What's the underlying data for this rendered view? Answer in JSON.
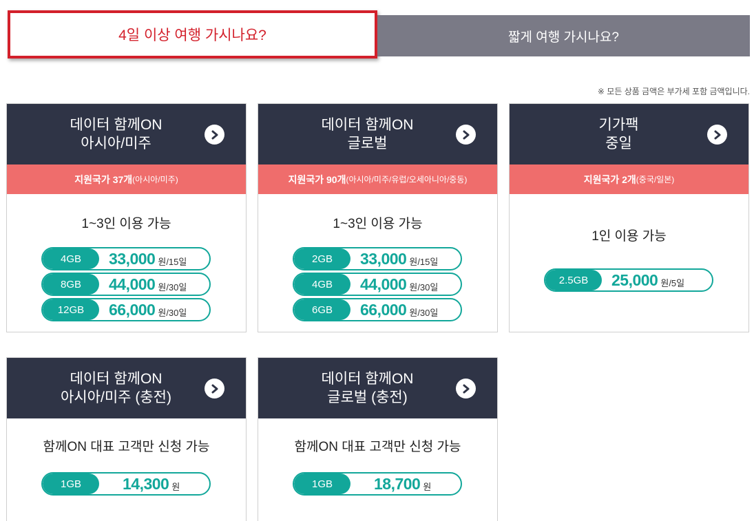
{
  "tabs": {
    "active_label": "4일 이상 여행 가시나요?",
    "inactive_label": "짧게 여행 가시나요?"
  },
  "vat_note": "※ 모든 상품 금액은 부가세 포함 금액입니다.",
  "cards": [
    {
      "title_line1": "데이터 함께ON",
      "title_line2": "아시아/미주",
      "support_main": "지원국가 37개",
      "support_detail": "(아시아/미주)",
      "usage": "1~3인 이용 가능",
      "plans": [
        {
          "gb": "4GB",
          "price": "33,000",
          "unit": "원/15일"
        },
        {
          "gb": "8GB",
          "price": "44,000",
          "unit": "원/30일"
        },
        {
          "gb": "12GB",
          "price": "66,000",
          "unit": "원/30일"
        }
      ]
    },
    {
      "title_line1": "데이터 함께ON",
      "title_line2": "글로벌",
      "support_main": "지원국가 90개",
      "support_detail": "(아시아/미주/유럽/오세아니아/중동)",
      "usage": "1~3인 이용 가능",
      "plans": [
        {
          "gb": "2GB",
          "price": "33,000",
          "unit": "원/15일"
        },
        {
          "gb": "4GB",
          "price": "44,000",
          "unit": "원/30일"
        },
        {
          "gb": "6GB",
          "price": "66,000",
          "unit": "원/30일"
        }
      ]
    },
    {
      "title_line1": "기가팩",
      "title_line2": "중일",
      "support_main": "지원국가 2개",
      "support_detail": "(중국/일본)",
      "usage": "1인 이용 가능",
      "plans": [
        {
          "gb": "2.5GB",
          "price": "25,000",
          "unit": "원/5일"
        }
      ]
    },
    {
      "title_line1": "데이터 함께ON",
      "title_line2": "아시아/미주 (충전)",
      "usage": "함께ON 대표 고객만 신청 가능",
      "plans": [
        {
          "gb": "1GB",
          "price": "14,300",
          "unit": "원"
        }
      ]
    },
    {
      "title_line1": "데이터 함께ON",
      "title_line2": "글로벌 (충전)",
      "usage": "함께ON 대표 고객만 신청 가능",
      "plans": [
        {
          "gb": "1GB",
          "price": "18,700",
          "unit": "원"
        }
      ]
    }
  ]
}
